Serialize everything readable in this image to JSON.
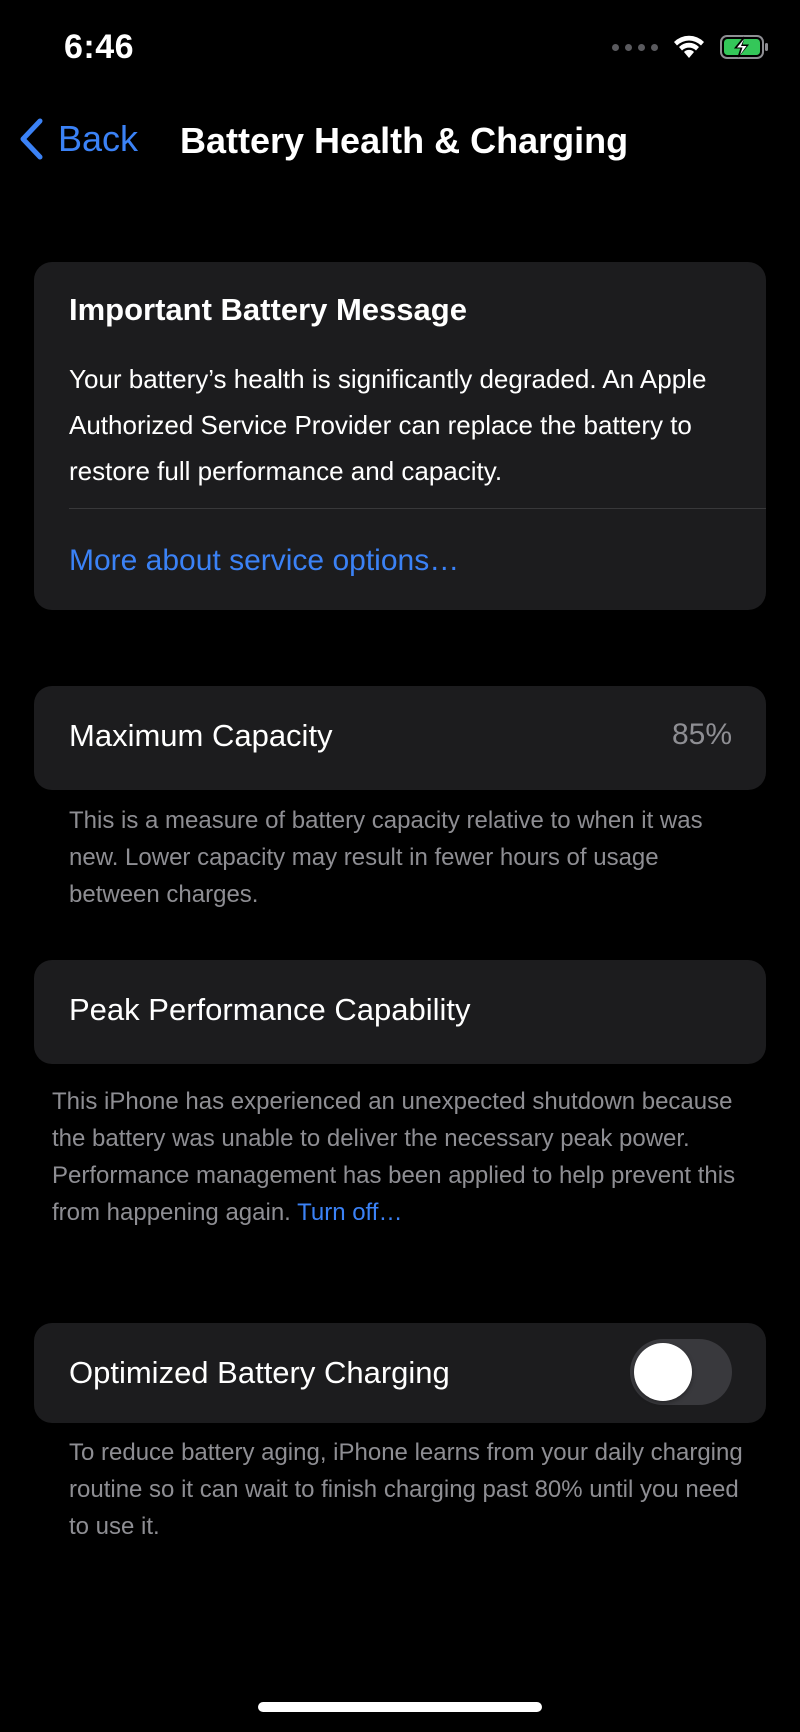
{
  "status_bar": {
    "time": "6:46",
    "icons": [
      "cellular-signal-icon",
      "wifi-icon",
      "battery-charging-icon"
    ],
    "battery_color": "#34c759"
  },
  "nav": {
    "back_label": "Back",
    "title": "Battery Health & Charging"
  },
  "important_message": {
    "title": "Important Battery Message",
    "body": "Your battery’s health is significantly degraded. An Apple Authorized Service Provider can replace the battery to restore full performance and capacity.",
    "link": "More about service options…"
  },
  "maximum_capacity": {
    "label": "Maximum Capacity",
    "value": "85%",
    "note": "This is a measure of battery capacity relative to when it was new. Lower capacity may result in fewer hours of usage between charges."
  },
  "peak_performance": {
    "label": "Peak Performance Capability",
    "note": "This iPhone has experienced an unexpected shutdown because the battery was unable to deliver the necessary peak power. Performance management has been applied to help prevent this from happening again.",
    "link": "Turn off…"
  },
  "optimized_charging": {
    "label": "Optimized Battery Charging",
    "enabled": false,
    "note": "To reduce battery aging, iPhone learns from your daily charging routine so it can wait to finish charging past 80% until you need to use it."
  },
  "colors": {
    "accent": "#3b82f6",
    "card_background": "#1c1c1e",
    "secondary_text": "#8e8e93"
  }
}
